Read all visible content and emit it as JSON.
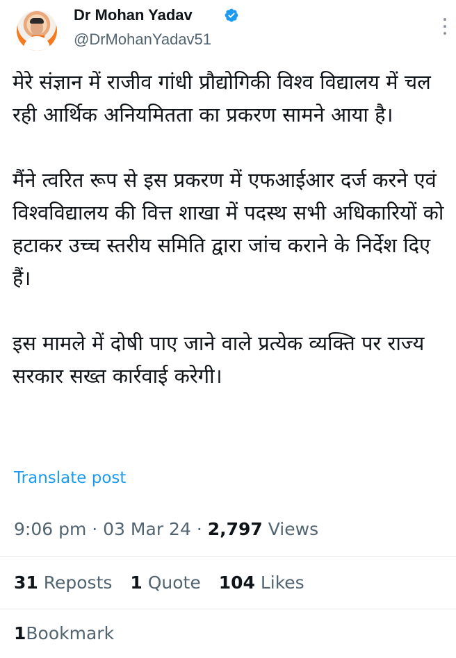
{
  "author": {
    "name": "Dr Mohan Yadav",
    "handle": "@DrMohanYadav51",
    "verified": true,
    "verified_color": "#1d9bf0"
  },
  "post": {
    "paragraphs": [
      "मेरे संज्ञान में राजीव गांधी प्रौद्योगिकी विश्व विद्यालय में चल रही आर्थिक अनियमितता का प्रकरण सामने आया है।",
      "मैंने त्वरित रूप से इस प्रकरण में एफआईआर दर्ज करने एवं विश्वविद्यालय की वित्त शाखा में पदस्थ सभी अधिकारियों को हटाकर उच्च स्तरीय समिति द्वारा जांच कराने के निर्देश दिए हैं।",
      "इस मामले में दोषी पाए जाने वाले प्रत्येक व्यक्ति पर राज्य सरकार सख्त कार्रवाई करेगी।"
    ],
    "translate_label": "Translate post",
    "time": "9:06 pm",
    "date": "03 Mar 24",
    "separator": "·",
    "views_count": "2,797",
    "views_label": "Views"
  },
  "stats": {
    "reposts_count": "31",
    "reposts_label": "Reposts",
    "quotes_count": "1",
    "quotes_label": "Quote",
    "likes_count": "104",
    "likes_label": "Likes",
    "bookmarks_count": "1",
    "bookmarks_label": "Bookmark"
  },
  "colors": {
    "link": "#1d9bf0",
    "secondary_text": "#536471",
    "primary_text": "#0f1419"
  },
  "icons": {
    "verified": "verified-badge-icon",
    "more": "more-vertical-icon"
  }
}
